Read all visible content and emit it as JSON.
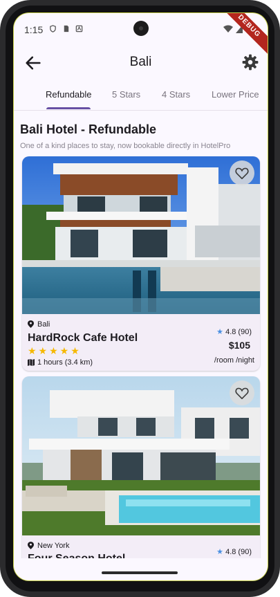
{
  "status": {
    "time": "1:15",
    "debug_label": "DEBUG"
  },
  "appbar": {
    "title": "Bali",
    "back_icon": "arrow-back-icon",
    "settings_icon": "gear-icon"
  },
  "tabs": [
    {
      "label": "Refundable",
      "active": true
    },
    {
      "label": "5 Stars",
      "active": false
    },
    {
      "label": "4 Stars",
      "active": false
    },
    {
      "label": "Lower Price",
      "active": false
    }
  ],
  "section": {
    "title": "Bali Hotel - Refundable",
    "subtitle": "One of a kind places to stay, now bookable directly in HotelPro"
  },
  "hotels": [
    {
      "location": "Bali",
      "name": "HardRock Cafe Hotel",
      "stars": "★★★★★",
      "distance": "1 hours (3.4 km)",
      "rating": "4.8 (90)",
      "price": "$105",
      "per": "/room /night"
    },
    {
      "location": "New York",
      "name": "Four Season Hotel",
      "rating": "4.8 (90)"
    }
  ],
  "colors": {
    "accent": "#6750a4",
    "star": "#f5b800",
    "rating_star": "#4a90e2"
  }
}
